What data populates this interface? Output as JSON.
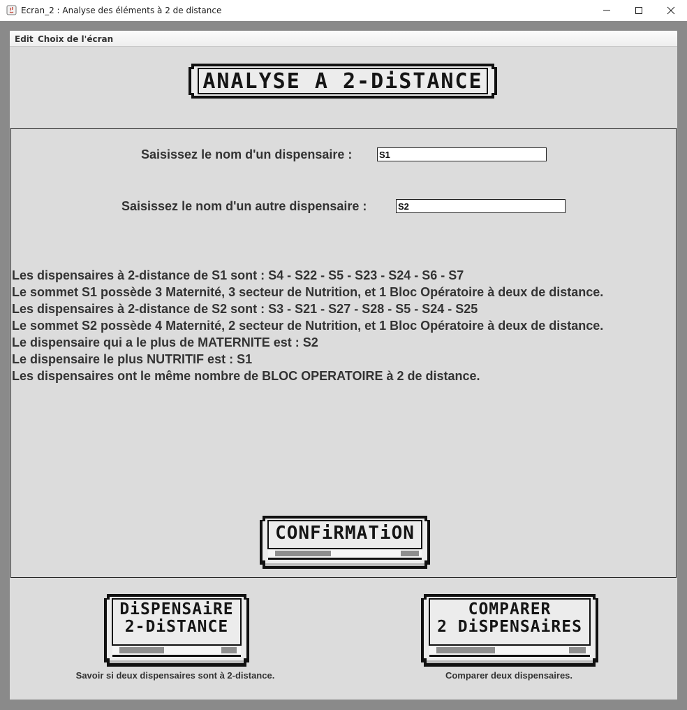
{
  "window": {
    "title": "Ecran_2 : Analyse des éléments à 2 de distance"
  },
  "menu": {
    "items": [
      "Edit",
      "Choix de l'écran"
    ]
  },
  "header": {
    "banner_text": "ANALYSE A 2-DiSTANCE"
  },
  "form": {
    "prompt1": "Saisissez le nom d'un dispensaire :",
    "value1": "S1",
    "prompt2": "Saisissez le nom d'un autre dispensaire :",
    "value2": "S2"
  },
  "results": [
    "Les dispensaires à 2-distance de S1 sont : S4 - S22 - S5 - S23 - S24 - S6 - S7",
    "Le sommet S1 possède 3 Maternité, 3 secteur de Nutrition, et 1 Bloc Opératoire à deux de distance.",
    "Les dispensaires à 2-distance de S2 sont : S3 - S21 - S27 - S28 - S5 - S24 - S25",
    "Le sommet S2 possède 4 Maternité, 2 secteur de Nutrition, et 1 Bloc Opératoire à deux de distance.",
    "Le dispensaire qui a le plus de MATERNITE est : S2",
    "Le dispensaire le plus NUTRITIF est : S1",
    "Les dispensaires ont le même nombre de BLOC OPERATOIRE à 2 de distance."
  ],
  "buttons": {
    "confirm": "CONFiRMATiON",
    "nav_left": {
      "line1": "DiSPENSAiRE",
      "line2": "2-DiSTANCE",
      "caption": "Savoir si deux dispensaires sont à 2-distance."
    },
    "nav_right": {
      "line1": "COMPARER",
      "line2": "2 DiSPENSAiRES",
      "caption": "Comparer deux dispensaires."
    }
  },
  "colors": {
    "window_bg": "#dcdcdc",
    "outer_bg": "#8a8a8a",
    "text": "#333333",
    "button_face": "#ececec",
    "button_outline": "#111111"
  }
}
